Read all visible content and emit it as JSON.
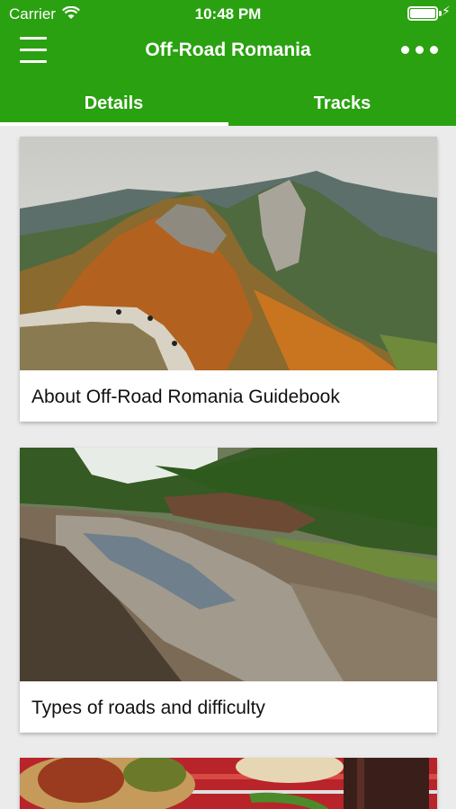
{
  "status_bar": {
    "carrier": "Carrier",
    "time": "10:48 PM"
  },
  "nav": {
    "title": "Off-Road Romania",
    "menu_icon": "hamburger-menu-icon",
    "more_icon": "more-dots-icon"
  },
  "tabs": [
    {
      "label": "Details",
      "selected": true
    },
    {
      "label": "Tracks",
      "selected": false
    }
  ],
  "cards": [
    {
      "title": "About Off-Road Romania Guidebook",
      "image": "mountain-road-autumn-photo"
    },
    {
      "title": "Types of roads and difficulty",
      "image": "muddy-forest-road-photo"
    },
    {
      "title": "",
      "image": "food-table-photo"
    }
  ],
  "colors": {
    "primary": "#2aa110",
    "background": "#ebebeb"
  }
}
